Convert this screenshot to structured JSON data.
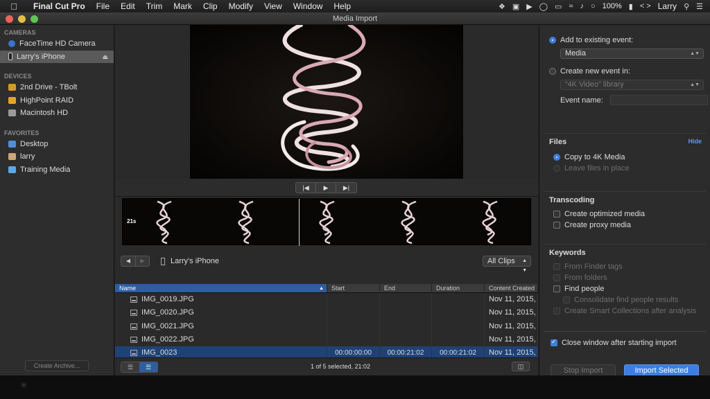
{
  "menubar": {
    "app_name": "Final Cut Pro",
    "menus": [
      "File",
      "Edit",
      "Trim",
      "Mark",
      "Clip",
      "Modify",
      "View",
      "Window",
      "Help"
    ],
    "battery": "100%",
    "user": "Larry"
  },
  "window": {
    "title": "Media Import"
  },
  "sidebar": {
    "cameras_header": "CAMERAS",
    "cameras": [
      {
        "label": "FaceTime HD Camera",
        "icon": "camera-icon"
      },
      {
        "label": "Larry's iPhone",
        "icon": "iphone-icon",
        "selected": true
      }
    ],
    "devices_header": "DEVICES",
    "devices": [
      {
        "label": "2nd Drive - TBolt",
        "icon": "drive-icon"
      },
      {
        "label": "HighPoint RAID",
        "icon": "drive-icon"
      },
      {
        "label": "Macintosh HD",
        "icon": "drive-icon"
      }
    ],
    "favorites_header": "FAVORITES",
    "favorites": [
      {
        "label": "Desktop",
        "icon": "desktop-icon"
      },
      {
        "label": "larry",
        "icon": "home-icon"
      },
      {
        "label": "Training Media",
        "icon": "folder-icon"
      }
    ],
    "create_archive": "Create Archive..."
  },
  "filmstrip": {
    "length_label": "21s"
  },
  "browser": {
    "device_name": "Larry's iPhone",
    "filter": "All Clips",
    "columns": [
      "Name",
      "Start",
      "End",
      "Duration",
      "Content Created"
    ],
    "rows": [
      {
        "name": "IMG_0019.JPG",
        "start": "",
        "end": "",
        "duration": "",
        "created": "Nov 11, 2015,"
      },
      {
        "name": "IMG_0020.JPG",
        "start": "",
        "end": "",
        "duration": "",
        "created": "Nov 11, 2015,"
      },
      {
        "name": "IMG_0021.JPG",
        "start": "",
        "end": "",
        "duration": "",
        "created": "Nov 11, 2015,"
      },
      {
        "name": "IMG_0022.JPG",
        "start": "",
        "end": "",
        "duration": "",
        "created": "Nov 11, 2015,"
      },
      {
        "name": "IMG_0023",
        "start": "00:00:00:00",
        "end": "00:00:21:02",
        "duration": "00:00:21:02",
        "created": "Nov 11, 2015,",
        "selected": true
      }
    ],
    "status": "1 of 5 selected, 21:02"
  },
  "import_options": {
    "add_existing_label": "Add to existing event:",
    "existing_event": "Media",
    "create_new_label": "Create new event in:",
    "library": "“4K Video” library",
    "event_name_label": "Event name:",
    "files_title": "Files",
    "hide_label": "Hide",
    "copy_label": "Copy to 4K Media",
    "leave_label": "Leave files in place",
    "transcoding_title": "Transcoding",
    "optimized_label": "Create optimized media",
    "proxy_label": "Create proxy media",
    "keywords_title": "Keywords",
    "finder_tags_label": "From Finder tags",
    "folders_label": "From folders",
    "find_people_label": "Find people",
    "consolidate_label": "Consolidate find people results",
    "smart_collections_label": "Create Smart Collections after analysis",
    "close_window_label": "Close window after starting import",
    "stop_import": "Stop Import",
    "import_selected": "Import Selected"
  }
}
